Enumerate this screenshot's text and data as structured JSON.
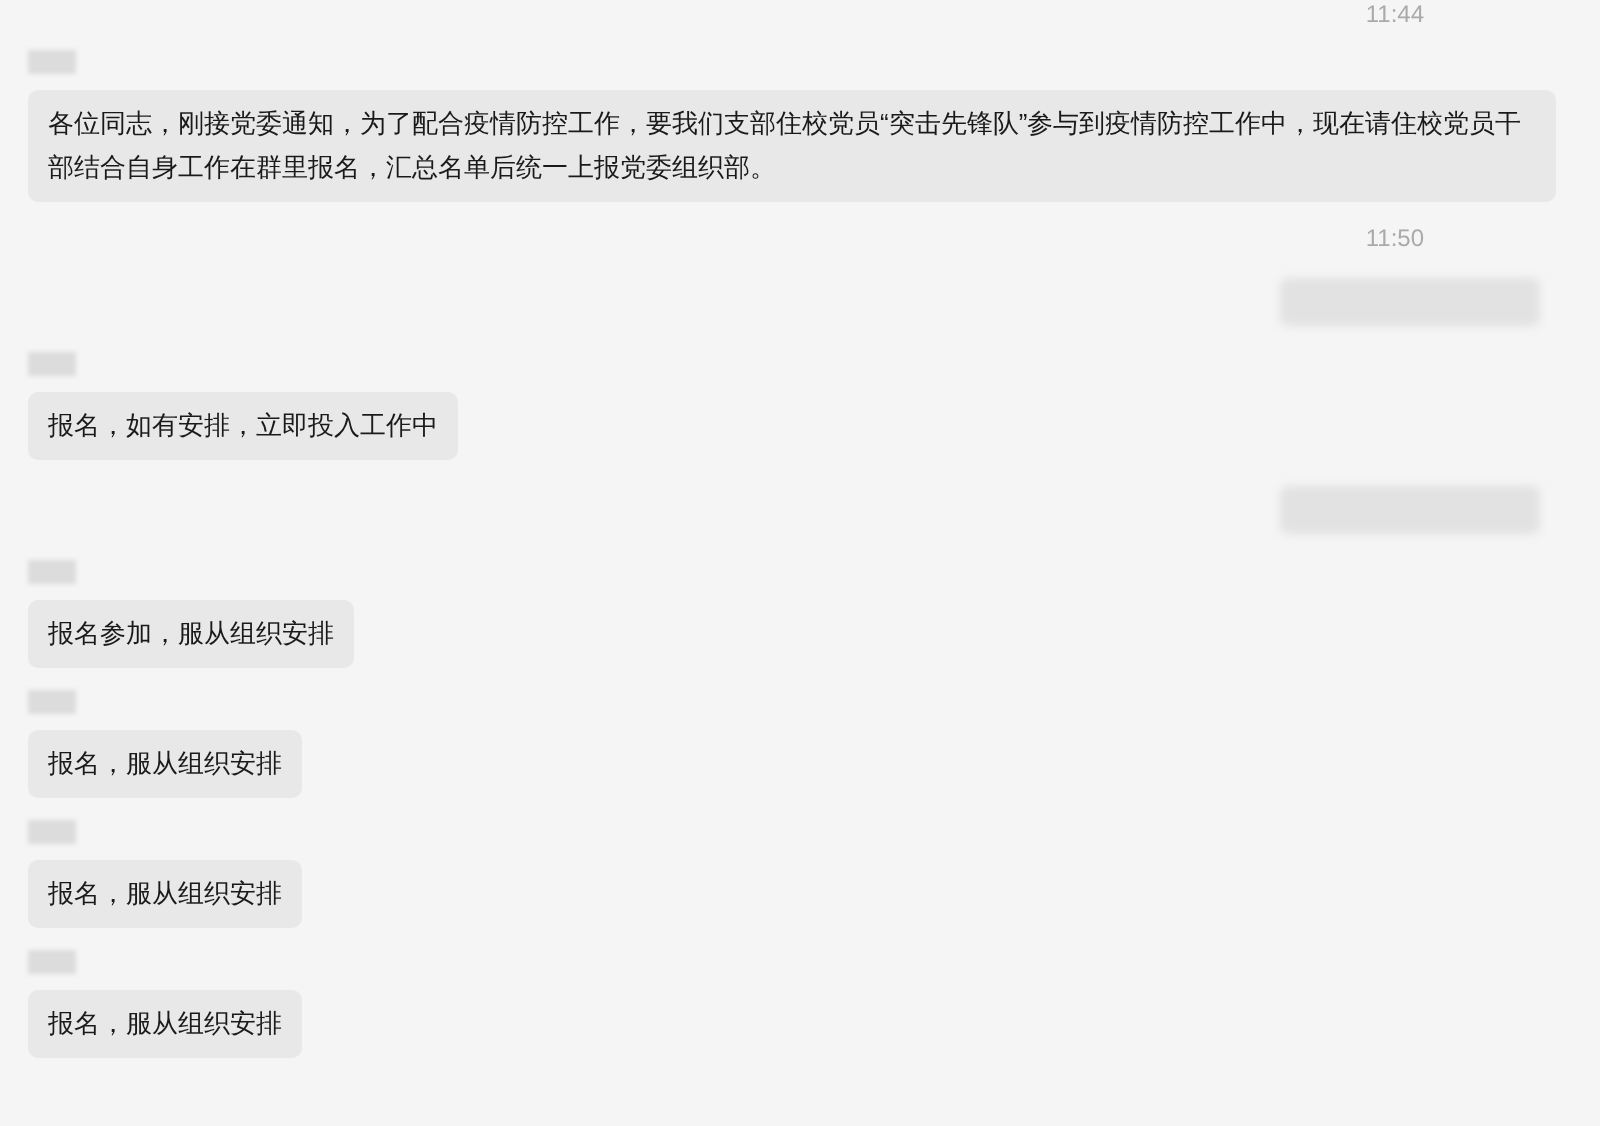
{
  "messages": [
    {
      "kind": "time",
      "text": "11:44"
    },
    {
      "kind": "incoming",
      "text": "各位同志，刚接党委通知，为了配合疫情防控工作，要我们支部住校党员“突击先锋队”参与到疫情防控工作中，现在请住校党员干部结合自身工作在群里报名，汇总名单后统一上报党委组织部。"
    },
    {
      "kind": "time",
      "text": "11:50"
    },
    {
      "kind": "outgoing"
    },
    {
      "kind": "incoming",
      "text": "报名，如有安排，立即投入工作中"
    },
    {
      "kind": "outgoing"
    },
    {
      "kind": "incoming",
      "text": "报名参加，服从组织安排"
    },
    {
      "kind": "incoming",
      "text": "报名，服从组织安排"
    },
    {
      "kind": "incoming",
      "text": "报名，服从组织安排"
    },
    {
      "kind": "incoming",
      "text": "报名，服从组织安排"
    }
  ]
}
